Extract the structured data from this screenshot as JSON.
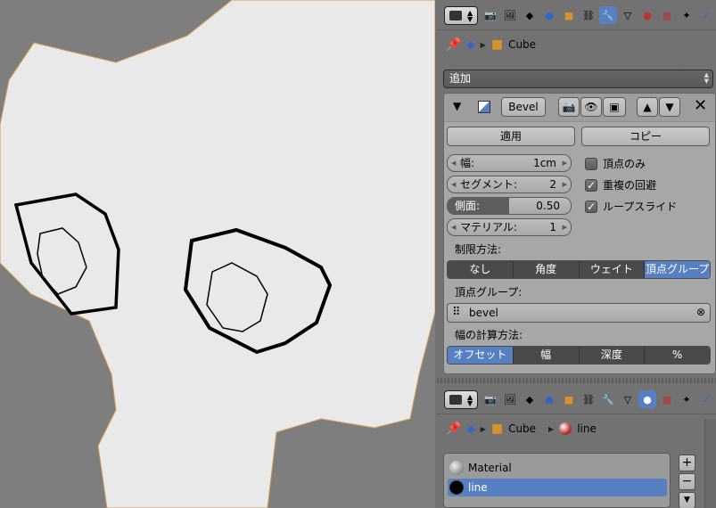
{
  "header_icons": [
    "render-icon",
    "render-layers-icon",
    "scene-icon",
    "world-icon",
    "object-icon",
    "constraints-icon",
    "modifiers-icon",
    "data-icon",
    "material-icon",
    "texture-icon",
    "particles-icon",
    "physics-icon"
  ],
  "top_path": {
    "object_name": "Cube"
  },
  "add_modifier": {
    "label": "追加"
  },
  "modifier": {
    "name": "Bevel",
    "apply_label": "適用",
    "copy_label": "コピー",
    "fields": [
      {
        "label": "幅:",
        "value": "1cm"
      },
      {
        "label": "セグメント:",
        "value": "2"
      },
      {
        "label": "側面:",
        "value": "0.50",
        "fill": 0.5
      },
      {
        "label": "マテリアル:",
        "value": "1"
      }
    ],
    "checkboxes": [
      {
        "label": "頂点のみ",
        "checked": false
      },
      {
        "label": "重複の回避",
        "checked": true
      },
      {
        "label": "ループスライド",
        "checked": true
      }
    ],
    "limit_method_label": "制限方法:",
    "limit_methods": [
      "なし",
      "角度",
      "ウェイト",
      "頂点グループ"
    ],
    "limit_method_selected": 3,
    "vertex_group_label": "頂点グループ:",
    "vertex_group_value": "bevel",
    "width_method_label": "幅の計算方法:",
    "width_methods": [
      "オフセット",
      "幅",
      "深度",
      "%"
    ],
    "width_method_selected": 0
  },
  "bottom_path": {
    "object_name": "Cube",
    "material_name": "line"
  },
  "materials": [
    {
      "name": "Material",
      "color": "#9c9c9c"
    },
    {
      "name": "line",
      "color": "#000000"
    }
  ],
  "colors": {
    "accent": "#5680c2",
    "viewport_bg": "#7e7e7e",
    "mesh_fill": "#e9e9e9",
    "edge_outline": "#d89a4a"
  }
}
